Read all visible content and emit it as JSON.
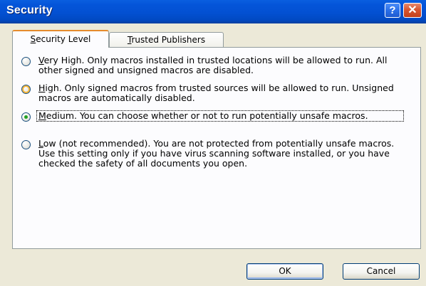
{
  "window": {
    "title": "Security",
    "help_label": "?",
    "close_label": "✕"
  },
  "tabs": [
    {
      "label": "Security Level",
      "active": true
    },
    {
      "label": "Trusted Publishers",
      "active": false
    }
  ],
  "options": [
    {
      "id": "very-high",
      "text": "Very High. Only macros installed in trusted locations will be allowed to run. All other signed and unsigned macros are disabled.",
      "selected": false
    },
    {
      "id": "high",
      "text": "High. Only signed macros from trusted sources will be allowed to run. Unsigned macros are automatically disabled.",
      "selected": false
    },
    {
      "id": "medium",
      "text": "Medium. You can choose whether or not to run potentially unsafe macros.",
      "selected": true
    },
    {
      "id": "low",
      "text": "Low (not recommended). You are not protected from potentially unsafe macros. Use this setting only if you have virus scanning software installed, or you have checked the safety of all documents you open.",
      "selected": false
    }
  ],
  "buttons": {
    "ok": "OK",
    "cancel": "Cancel"
  },
  "colors": {
    "titlebar": "#0350d2",
    "tab_highlight": "#e68b2c",
    "radio_selected": "#21a121"
  }
}
